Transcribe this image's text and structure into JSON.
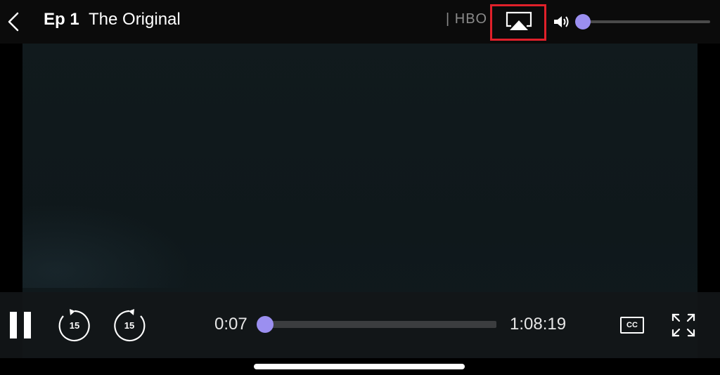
{
  "header": {
    "episode": "Ep 1",
    "title": "The Original",
    "network": "| HBO"
  },
  "icons": {
    "back": "back-chevron-icon",
    "airplay": "airplay-icon",
    "volume": "volume-icon",
    "pause": "pause-icon",
    "rewind": "rewind-15-icon",
    "forward": "forward-15-icon",
    "captions": "closed-captions-icon",
    "fullscreen": "fullscreen-icon"
  },
  "volume": {
    "level": 0
  },
  "playback": {
    "current_time": "0:07",
    "duration": "1:08:19",
    "progress": 0.002,
    "rewind_seconds": "15",
    "forward_seconds": "15"
  },
  "captions_label": "CC",
  "colors": {
    "accent": "#9b8ff0",
    "highlight_box": "#e0202a",
    "background": "#000000",
    "video": "#111a1d"
  }
}
